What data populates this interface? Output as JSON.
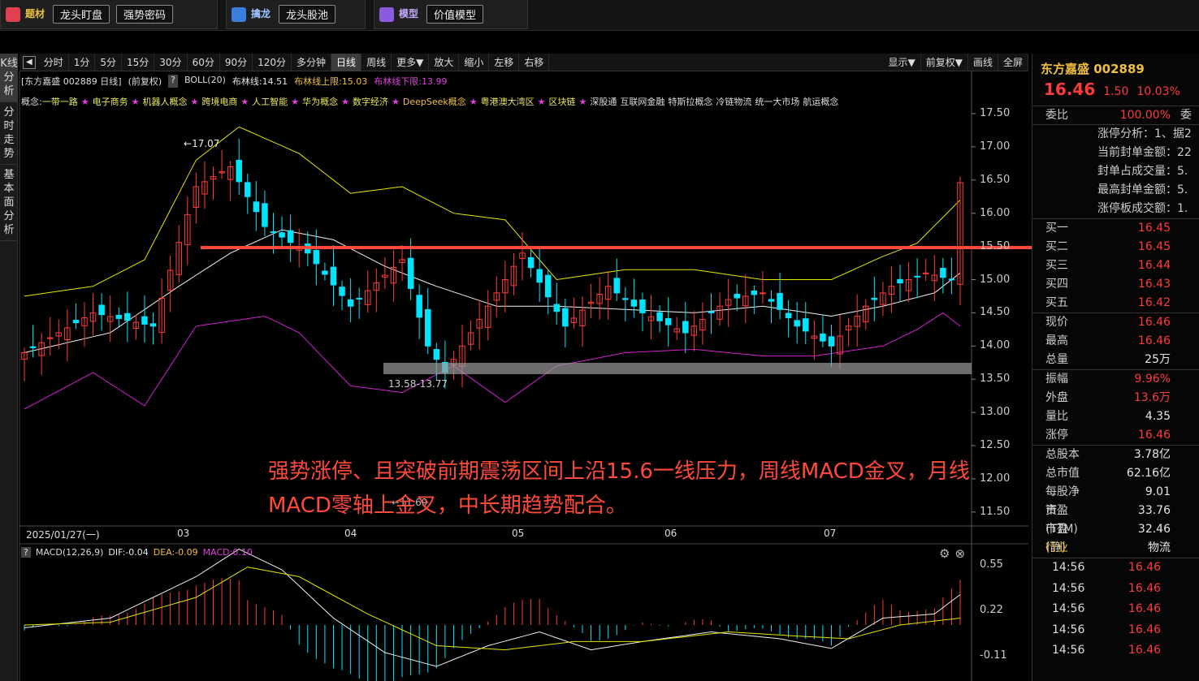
{
  "topbar": {
    "groups": [
      {
        "label": "题材",
        "buttons": [
          "龙头盯盘",
          "强势密码"
        ]
      },
      {
        "label": "擒龙",
        "buttons": [
          "龙头股池"
        ]
      },
      {
        "label": "模型",
        "buttons": [
          "价值模型"
        ]
      }
    ]
  },
  "left_tabs": [
    "K线分析",
    "分时走势",
    "基本面分析"
  ],
  "period_toolbar": {
    "periods": [
      "分时",
      "1分",
      "5分",
      "15分",
      "30分",
      "60分",
      "90分",
      "120分",
      "多分钟",
      "日线",
      "周线",
      "更多▼",
      "放大",
      "缩小",
      "左移",
      "右移"
    ],
    "active": "日线",
    "right": [
      "显示▼",
      "前复权▼",
      "画线",
      "全屏"
    ]
  },
  "info": {
    "stock": "[东方嘉盛 002889 日线]",
    "adjust": "(前复权)",
    "help": "?",
    "boll": "BOLL(20)",
    "mid": "布林线:14.51",
    "upper": "布林线上限:15.03",
    "lower": "布林线下限:13.99"
  },
  "concepts": {
    "prefix": "概念:",
    "items": [
      "一带一路",
      "电子商务",
      "机器人概念",
      "跨境电商",
      "人工智能",
      "华为概念",
      "数字经济",
      "DeepSeek概念",
      "粤港澳大湾区",
      "区块链",
      "深股通",
      "互联网金融",
      "特斯拉概念",
      "冷链物流",
      "统一大市场",
      "航运概念"
    ],
    "starred": [
      true,
      true,
      true,
      true,
      true,
      true,
      true,
      true,
      true,
      true,
      false,
      false,
      false,
      false,
      false,
      false
    ]
  },
  "annotation": "强势涨停、且突破前期震荡区间上沿15.6一线压力，周线MACD金叉，月线MACD零轴上金叉，中长期趋势配合。",
  "range_label": "13.58-13.77",
  "high_label": "17.07",
  "low_label": "11.69",
  "date_label": "2025/01/27(一)",
  "month_labels": [
    "03",
    "04",
    "05",
    "06",
    "07"
  ],
  "macd": {
    "name": "MACD(12,26,9)",
    "dif": "DIF:-0.04",
    "dea": "DEA:-0.09",
    "macd": "MACD:0.10",
    "levels": [
      "0.55",
      "0.22",
      "-0.11"
    ]
  },
  "price_levels": [
    "17.50",
    "17.00",
    "16.50",
    "16.00",
    "15.50",
    "15.00",
    "14.50",
    "14.00",
    "13.50",
    "13.00",
    "12.50",
    "12.00",
    "11.50"
  ],
  "right_panel": {
    "title": "东方嘉盛 002889",
    "price": "16.46",
    "change": "1.50",
    "pct": "10.03%",
    "weibi_label": "委比",
    "weibi": "100.00%",
    "weibi_extra": "委",
    "limit_info": [
      "涨停分析：1、据2",
      "当前封单金额：22",
      "封单占成交量：5.",
      "最高封单金额：5.",
      "涨停板成交额：1."
    ],
    "bids": [
      {
        "label": "买一",
        "value": "16.45"
      },
      {
        "label": "买二",
        "value": "16.45"
      },
      {
        "label": "买三",
        "value": "16.44"
      },
      {
        "label": "买四",
        "value": "16.43"
      },
      {
        "label": "买五",
        "value": "16.42"
      }
    ],
    "stats1": [
      {
        "label": "现价",
        "value": "16.46",
        "color": "red"
      },
      {
        "label": "最高",
        "value": "16.46",
        "color": "red"
      },
      {
        "label": "总量",
        "value": "25万",
        "color": "white"
      }
    ],
    "stats2": [
      {
        "label": "振幅",
        "value": "9.96%",
        "color": "red"
      },
      {
        "label": "外盘",
        "value": "13.6万",
        "color": "red"
      },
      {
        "label": "量比",
        "value": "4.35",
        "color": "white"
      },
      {
        "label": "涨停",
        "value": "16.46",
        "color": "red"
      }
    ],
    "stats3": [
      {
        "label": "总股本",
        "value": "3.78亿",
        "color": "white"
      },
      {
        "label": "总市值",
        "value": "62.16亿",
        "color": "white"
      },
      {
        "label": "每股净资",
        "value": "9.01",
        "color": "white"
      },
      {
        "label": "市盈(TTM)",
        "value": "33.76",
        "color": "white"
      },
      {
        "label": "市盈(静)",
        "value": "32.46",
        "color": "white"
      }
    ],
    "industry_label": "行业",
    "industry": "物流",
    "ticks": [
      {
        "time": "14:56",
        "price": "16.46"
      },
      {
        "time": "14:56",
        "price": "16.46"
      },
      {
        "time": "14:56",
        "price": "16.46"
      },
      {
        "time": "14:56",
        "price": "16.46"
      },
      {
        "time": "14:56",
        "price": "16.46"
      }
    ]
  }
}
